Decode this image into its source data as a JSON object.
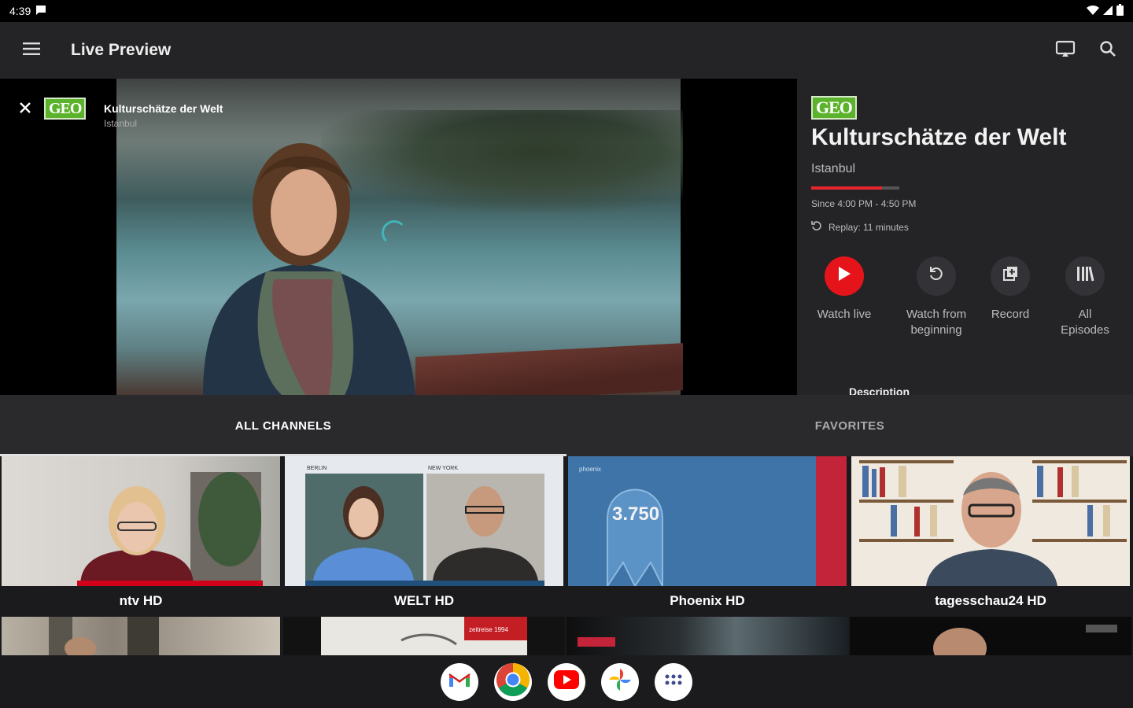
{
  "status_bar": {
    "time": "4:39"
  },
  "app_bar": {
    "title": "Live Preview"
  },
  "player": {
    "channel_logo": "GEO",
    "title": "Kulturschätze der Welt",
    "subtitle": "Istanbul"
  },
  "details": {
    "channel_logo": "GEO",
    "show_title": "Kulturschätze der Welt",
    "episode": "Istanbul",
    "progress": 0.8,
    "time": "Since 4:00 PM - 4:50 PM",
    "replay": "Replay: 11 minutes",
    "actions": [
      {
        "label": "Watch live",
        "icon": "play-icon"
      },
      {
        "label": "Watch from beginning",
        "icon": "restart-icon"
      },
      {
        "label": "Record",
        "icon": "record-icon"
      },
      {
        "label": "All Episodes",
        "icon": "library-icon"
      }
    ],
    "description_heading": "Description"
  },
  "tabs": [
    {
      "label": "ALL CHANNELS",
      "active": true
    },
    {
      "label": "FAVORITES",
      "active": false
    }
  ],
  "channels": [
    {
      "name": "ntv HD"
    },
    {
      "name": "WELT HD",
      "tags": [
        "BERLIN",
        "NEW YORK"
      ]
    },
    {
      "name": "Phoenix HD",
      "overlay": "3.750",
      "brand": "phoenix"
    },
    {
      "name": "tagesschau24 HD"
    }
  ],
  "row2_overlays": [
    "zeitreise 1994"
  ],
  "dock_apps": [
    "gmail-icon",
    "chrome-icon",
    "youtube-icon",
    "photos-icon",
    "app-drawer-icon"
  ],
  "colors": {
    "accent": "#e5141b",
    "geo_green": "#5bb22b",
    "background": "#1b1b1d"
  }
}
